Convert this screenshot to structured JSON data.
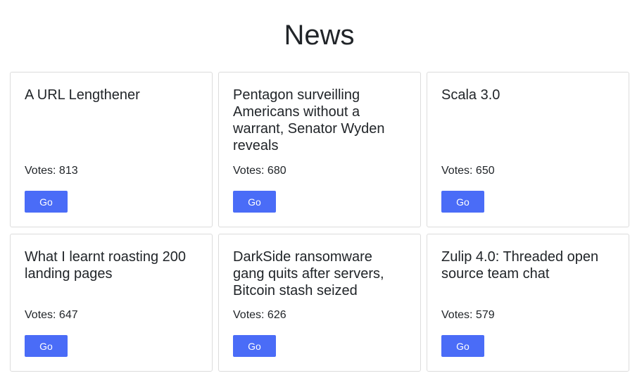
{
  "header": {
    "title": "News"
  },
  "colors": {
    "button_bg": "#4a6cf7",
    "button_text": "#ffffff",
    "card_border": "#dcdcdc",
    "text": "#212529"
  },
  "votes_prefix": "Votes: ",
  "cards": [
    {
      "title": "A URL Lengthener",
      "votes_label": "Votes: 813",
      "votes": 813,
      "button_label": "Go"
    },
    {
      "title": "Pentagon surveilling Americans without a warrant, Senator Wyden reveals",
      "votes_label": "Votes: 680",
      "votes": 680,
      "button_label": "Go"
    },
    {
      "title": "Scala 3.0",
      "votes_label": "Votes: 650",
      "votes": 650,
      "button_label": "Go"
    },
    {
      "title": "What I learnt roasting 200 landing pages",
      "votes_label": "Votes: 647",
      "votes": 647,
      "button_label": "Go"
    },
    {
      "title": "DarkSide ransomware gang quits after servers, Bitcoin stash seized",
      "votes_label": "Votes: 626",
      "votes": 626,
      "button_label": "Go"
    },
    {
      "title": "Zulip 4.0: Threaded open source team chat",
      "votes_label": "Votes: 579",
      "votes": 579,
      "button_label": "Go"
    }
  ]
}
